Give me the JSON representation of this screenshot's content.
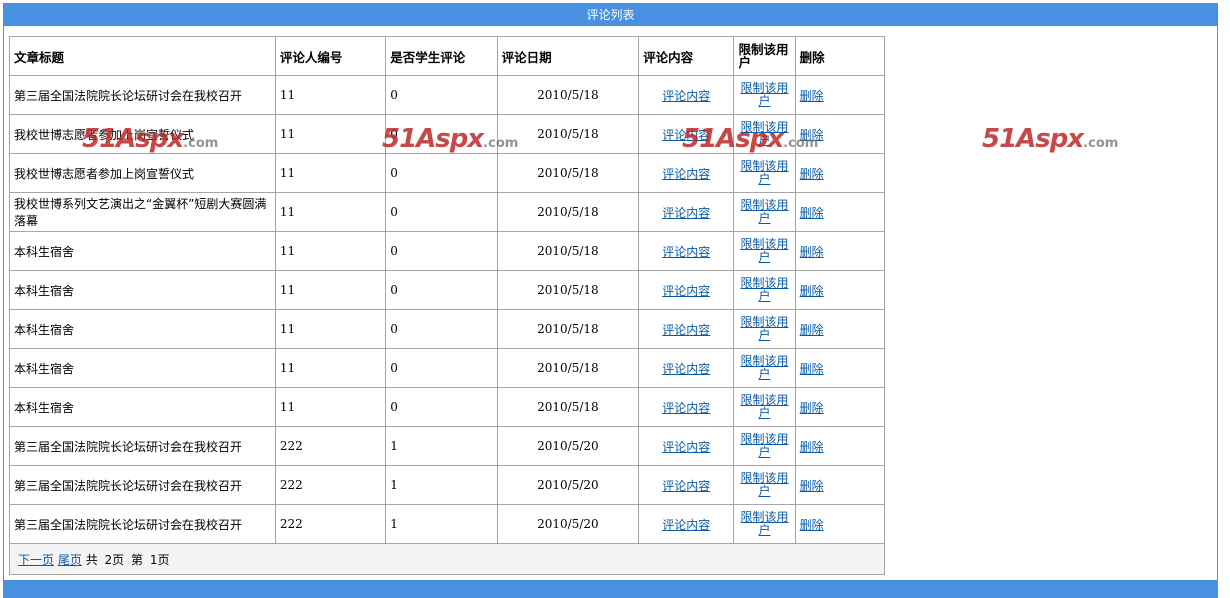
{
  "page": {
    "title": "评论列表"
  },
  "table": {
    "headers": {
      "title": "文章标题",
      "reviewer": "评论人编号",
      "is_student": "是否学生评论",
      "date": "评论日期",
      "content": "评论内容",
      "restrict": "限制该用户",
      "delete": "删除"
    },
    "rows": [
      {
        "title": "第三届全国法院院长论坛研讨会在我校召开",
        "reviewer": "11",
        "is_student": "0",
        "date": "2010/5/18",
        "content": "评论内容",
        "restrict": "限制该用户",
        "delete": "删除"
      },
      {
        "title": "我校世博志愿者参加上岗宣誓仪式",
        "reviewer": "11",
        "is_student": "0",
        "date": "2010/5/18",
        "content": "评论内容",
        "restrict": "限制该用户",
        "delete": "删除"
      },
      {
        "title": "我校世博志愿者参加上岗宣誓仪式",
        "reviewer": "11",
        "is_student": "0",
        "date": "2010/5/18",
        "content": "评论内容",
        "restrict": "限制该用户",
        "delete": "删除"
      },
      {
        "title": "我校世博系列文艺演出之“金翼杯”短剧大赛圆满落幕",
        "reviewer": "11",
        "is_student": "0",
        "date": "2010/5/18",
        "content": "评论内容",
        "restrict": "限制该用户",
        "delete": "删除"
      },
      {
        "title": "本科生宿舍",
        "reviewer": "11",
        "is_student": "0",
        "date": "2010/5/18",
        "content": "评论内容",
        "restrict": "限制该用户",
        "delete": "删除"
      },
      {
        "title": "本科生宿舍",
        "reviewer": "11",
        "is_student": "0",
        "date": "2010/5/18",
        "content": "评论内容",
        "restrict": "限制该用户",
        "delete": "删除"
      },
      {
        "title": "本科生宿舍",
        "reviewer": "11",
        "is_student": "0",
        "date": "2010/5/18",
        "content": "评论内容",
        "restrict": "限制该用户",
        "delete": "删除"
      },
      {
        "title": "本科生宿舍",
        "reviewer": "11",
        "is_student": "0",
        "date": "2010/5/18",
        "content": "评论内容",
        "restrict": "限制该用户",
        "delete": "删除"
      },
      {
        "title": "本科生宿舍",
        "reviewer": "11",
        "is_student": "0",
        "date": "2010/5/18",
        "content": "评论内容",
        "restrict": "限制该用户",
        "delete": "删除"
      },
      {
        "title": "第三届全国法院院长论坛研讨会在我校召开",
        "reviewer": "222",
        "is_student": "1",
        "date": "2010/5/20",
        "content": "评论内容",
        "restrict": "限制该用户",
        "delete": "删除"
      },
      {
        "title": "第三届全国法院院长论坛研讨会在我校召开",
        "reviewer": "222",
        "is_student": "1",
        "date": "2010/5/20",
        "content": "评论内容",
        "restrict": "限制该用户",
        "delete": "删除"
      },
      {
        "title": "第三届全国法院院长论坛研讨会在我校召开",
        "reviewer": "222",
        "is_student": "1",
        "date": "2010/5/20",
        "content": "评论内容",
        "restrict": "限制该用户",
        "delete": "删除"
      }
    ]
  },
  "pager": {
    "next": "下一页",
    "last": "尾页",
    "total_prefix": "共",
    "total_pages": "2页",
    "current_prefix": "第",
    "current_page": "1页"
  },
  "watermark": {
    "brand": "51Aspx",
    "suffix": ".com"
  },
  "colors": {
    "titlebar": "#4a90e2",
    "link": "#0a5aa8",
    "watermark": "#be2828"
  }
}
